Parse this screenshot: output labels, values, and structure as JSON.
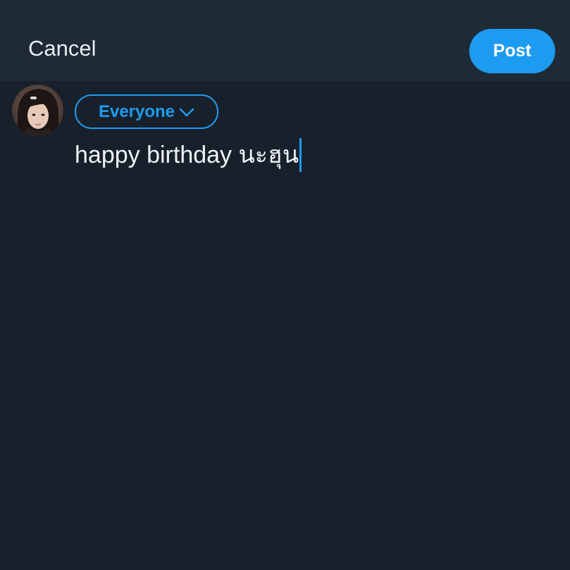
{
  "header": {
    "cancel_label": "Cancel",
    "post_label": "Post"
  },
  "composer": {
    "audience_label": "Everyone",
    "text": "happy birthday นะฮุน",
    "avatar_icon": "user-avatar"
  },
  "colors": {
    "accent": "#1d9bf0",
    "background": "#18202b",
    "header_background": "#1f2a37",
    "text": "#eef2f6"
  }
}
